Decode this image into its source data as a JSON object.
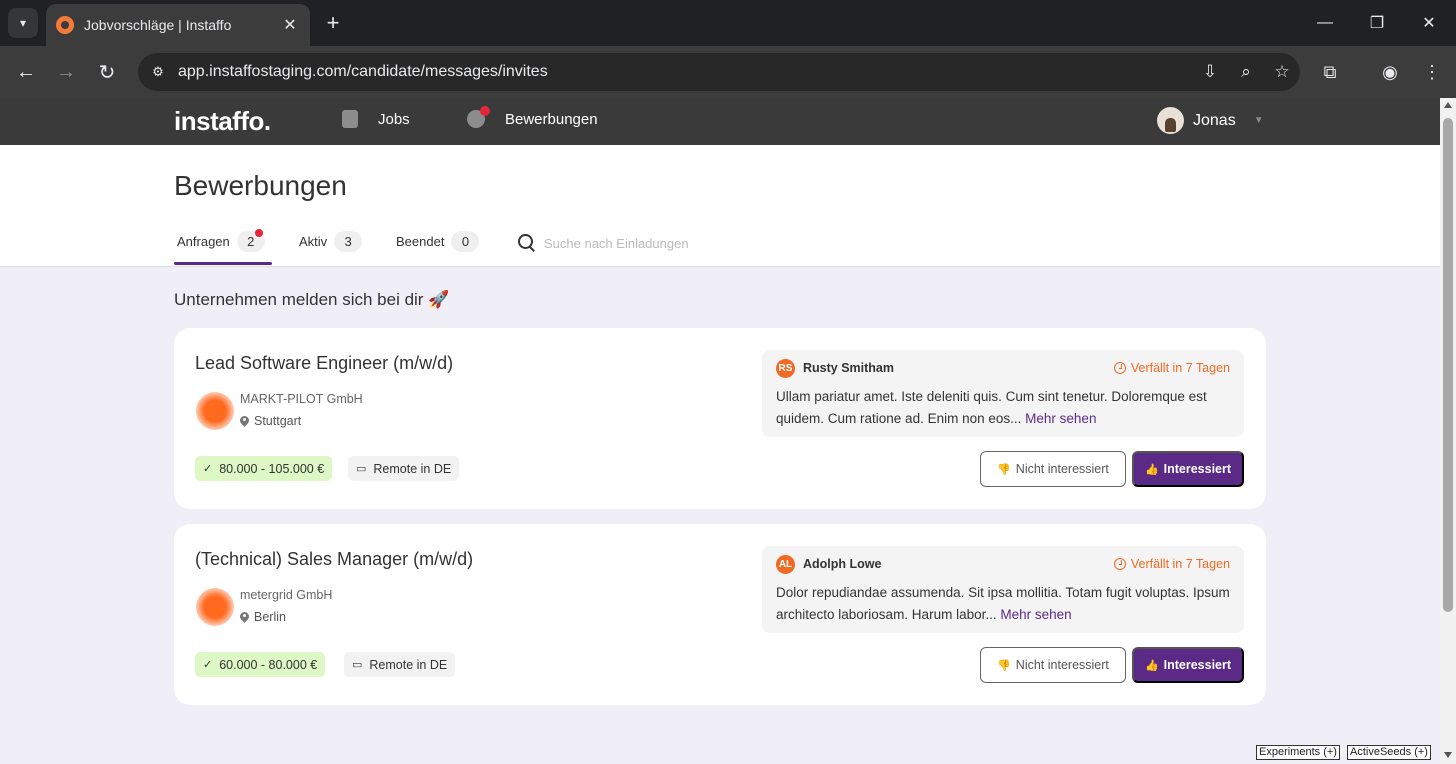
{
  "browser": {
    "tab_title": "Jobvorschläge | Instaffo",
    "url": "app.instaffostaging.com/candidate/messages/invites"
  },
  "header": {
    "logo": "instaffo.",
    "nav": [
      {
        "label": "Jobs",
        "icon": "document-icon"
      },
      {
        "label": "Bewerbungen",
        "icon": "chat-bubble-icon",
        "notification": true
      }
    ],
    "user_name": "Jonas"
  },
  "page": {
    "title": "Bewerbungen",
    "tabs": [
      {
        "label": "Anfragen",
        "count": "2",
        "active": true,
        "notification": true
      },
      {
        "label": "Aktiv",
        "count": "3"
      },
      {
        "label": "Beendet",
        "count": "0"
      }
    ],
    "search_placeholder": "Suche nach Einladungen",
    "section_title": "Unternehmen melden sich bei dir 🚀"
  },
  "invites": [
    {
      "job_title": "Lead Software Engineer (m/w/d)",
      "company": "MARKT-PILOT GmbH",
      "location": "Stuttgart",
      "salary": "80.000 - 105.000 €",
      "remote": "Remote in DE",
      "sender_initials": "RS",
      "sender_name": "Rusty Smitham",
      "expires": "Verfällt in 7 Tagen",
      "message": "Ullam pariatur amet. Iste deleniti quis. Cum sint tenetur. Doloremque est quidem. Cum ratione ad. Enim non eos...",
      "more_label": "Mehr sehen",
      "decline_label": "Nicht interessiert",
      "accept_label": "Interessiert"
    },
    {
      "job_title": "(Technical) Sales Manager (m/w/d)",
      "company": "metergrid GmbH",
      "location": "Berlin",
      "salary": "60.000 - 80.000 €",
      "remote": "Remote in DE",
      "sender_initials": "AL",
      "sender_name": "Adolph Lowe",
      "expires": "Verfällt in 7 Tagen",
      "message": "Dolor repudiandae assumenda. Sit ipsa mollitia. Totam fugit voluptas. Ipsum architecto laboriosam. Harum labor...",
      "more_label": "Mehr sehen",
      "decline_label": "Nicht interessiert",
      "accept_label": "Interessiert"
    }
  ],
  "dev_buttons": [
    "Experiments (+)",
    "ActiveSeeds (+)"
  ],
  "colors": {
    "brand_purple": "#5b2a86",
    "accent_orange": "#f06a24",
    "salary_green": "#ddf7c5",
    "notification_red": "#e5253a"
  }
}
